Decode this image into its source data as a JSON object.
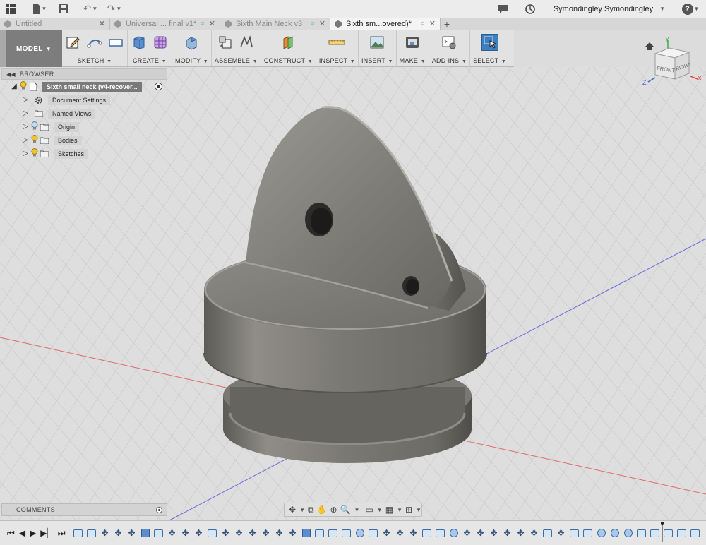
{
  "topbar": {
    "user_name": "Symondingley Symondingley",
    "help_label": "?"
  },
  "tabs": [
    {
      "label": "Untitled",
      "active": false,
      "status": ""
    },
    {
      "label": "Universal ... final v1*",
      "active": false,
      "status": "○"
    },
    {
      "label": "Sixth Main Neck v3",
      "active": false,
      "status": "○"
    },
    {
      "label": "Sixth sm...overed)*",
      "active": true,
      "status": "○"
    }
  ],
  "toolbar": {
    "workspace": "MODEL",
    "groups": [
      {
        "label": "SKETCH"
      },
      {
        "label": "CREATE"
      },
      {
        "label": "MODIFY"
      },
      {
        "label": "ASSEMBLE"
      },
      {
        "label": "CONSTRUCT"
      },
      {
        "label": "INSPECT"
      },
      {
        "label": "INSERT"
      },
      {
        "label": "MAKE"
      },
      {
        "label": "ADD-INS"
      },
      {
        "label": "SELECT"
      }
    ]
  },
  "browser": {
    "title": "BROWSER",
    "root": "Sixth small neck (v4-recover...",
    "nodes": [
      {
        "label": "Document Settings",
        "icon": "gear-icon",
        "bulb": false
      },
      {
        "label": "Named Views",
        "icon": "folder-icon",
        "bulb": false
      },
      {
        "label": "Origin",
        "icon": "folder-icon",
        "bulb": true,
        "bulb_color": "#a8c4e0"
      },
      {
        "label": "Bodies",
        "icon": "folder-icon",
        "bulb": true,
        "bulb_color": "#f1c232"
      },
      {
        "label": "Sketches",
        "icon": "folder-icon",
        "bulb": true,
        "bulb_color": "#f1c232"
      }
    ]
  },
  "viewcube": {
    "front": "FRONT",
    "right": "RIGHT",
    "axis_z": "Z",
    "axis_x": "X",
    "axis_y": "Y"
  },
  "comments": {
    "label": "COMMENTS"
  },
  "timeline": {
    "features": [
      "sketch",
      "sketch",
      "move",
      "move",
      "move",
      "extrude",
      "sketch",
      "move",
      "move",
      "move",
      "sketch",
      "move",
      "move",
      "move",
      "move",
      "move",
      "move",
      "extrude",
      "sketch",
      "sketch",
      "sketch",
      "fillet",
      "sketch",
      "move",
      "move",
      "move",
      "sketch",
      "sketch",
      "fillet",
      "move",
      "move",
      "move",
      "move",
      "move",
      "move",
      "sketch",
      "move",
      "sketch",
      "sketch",
      "fillet",
      "fillet",
      "fillet",
      "sketch",
      "sketch",
      "sketch",
      "sketch",
      "sketch"
    ]
  },
  "colors": {
    "accent_select": "#3e7fc0",
    "model_button": "#7d7d7d",
    "grid_line": "#c9c9c9",
    "x_axis": "#e06a6a",
    "z_axis": "#6a6ae0",
    "part_body": "#7d7b74"
  }
}
